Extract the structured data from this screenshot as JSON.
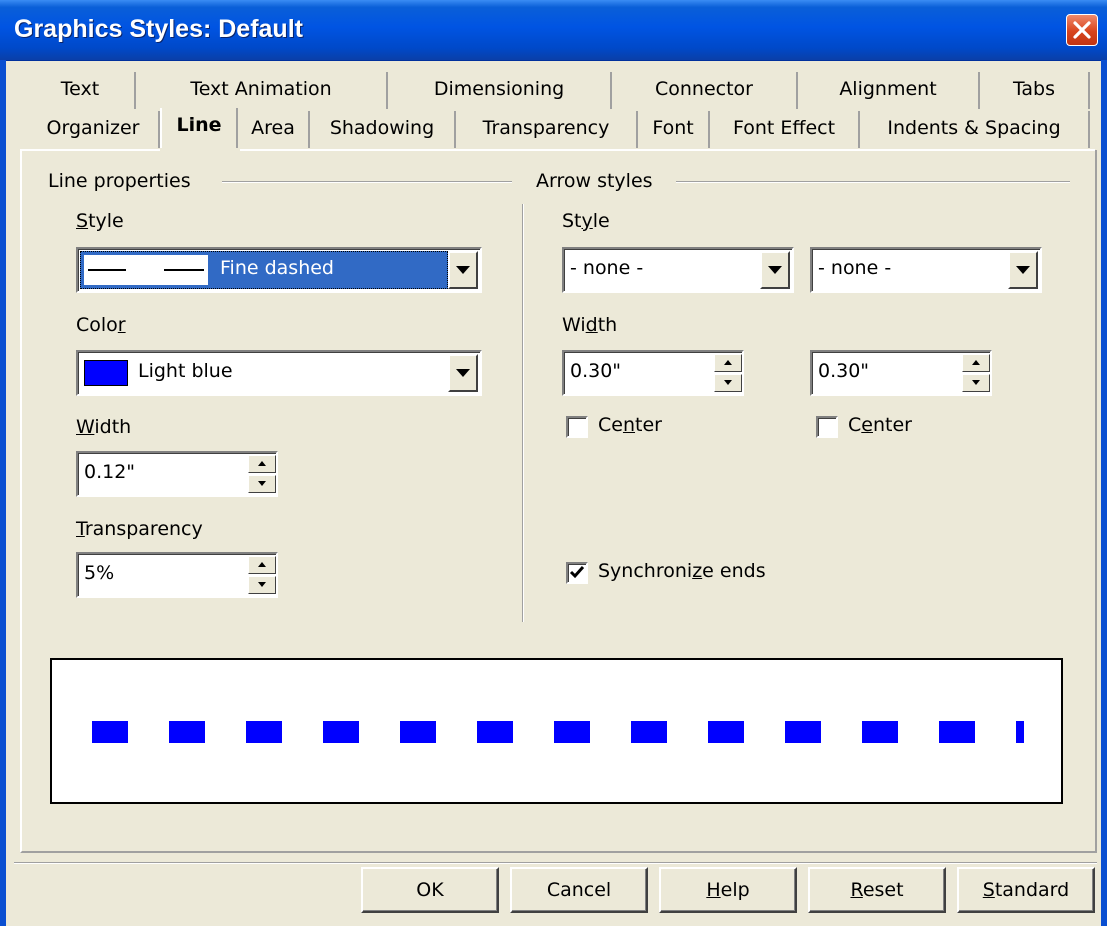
{
  "window": {
    "title": "Graphics Styles: Default"
  },
  "tabs_row1": [
    "Text",
    "Text Animation",
    "Dimensioning",
    "Connector",
    "Alignment",
    "Tabs"
  ],
  "tabs_row2": [
    "Organizer",
    "Line",
    "Area",
    "Shadowing",
    "Transparency",
    "Font",
    "Font Effect",
    "Indents & Spacing"
  ],
  "selected_tab": "Line",
  "line_properties": {
    "group_label": "Line properties",
    "style": {
      "label_u": "S",
      "label_rest": "tyle",
      "value": "Fine dashed"
    },
    "color": {
      "label_pre": "Colo",
      "label_u": "r",
      "value": "Light blue",
      "swatch": "#0000ff"
    },
    "width": {
      "label_u": "W",
      "label_rest": "idth",
      "value": "0.12\""
    },
    "transparency": {
      "label_u": "T",
      "label_rest": "ransparency",
      "value": "5%"
    }
  },
  "arrow_styles": {
    "group_label": "Arrow styles",
    "style": {
      "label_pre": "St",
      "label_u": "y",
      "label_rest": "le",
      "start_value": "- none -",
      "end_value": "- none -"
    },
    "width": {
      "label_pre": "Wi",
      "label_u": "d",
      "label_rest": "th",
      "start_value": "0.30\"",
      "end_value": "0.30\""
    },
    "center_start": {
      "label_pre": "Ce",
      "label_u": "n",
      "label_rest": "ter",
      "checked": false
    },
    "center_end": {
      "label_pre": "C",
      "label_u": "e",
      "label_rest": "nter",
      "checked": false
    },
    "synchronize": {
      "label_pre": "Synchroni",
      "label_u": "z",
      "label_rest": "e ends",
      "checked": true
    }
  },
  "preview": {
    "line_color": "#0000ff"
  },
  "buttons": {
    "ok": "OK",
    "cancel": "Cancel",
    "help": {
      "u": "H",
      "rest": "elp"
    },
    "reset": {
      "u": "R",
      "rest": "eset"
    },
    "standard": {
      "u": "S",
      "rest": "tandard"
    }
  }
}
